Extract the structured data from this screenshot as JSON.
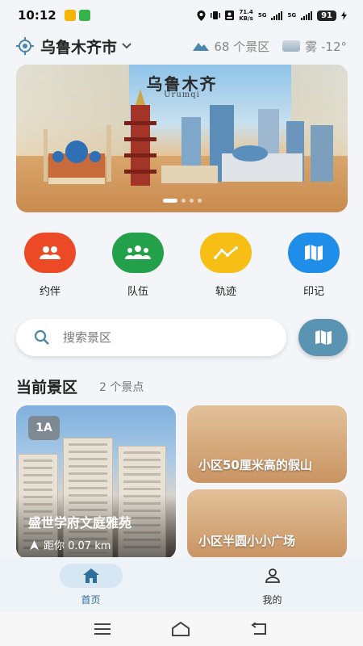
{
  "status_bar": {
    "time": "10:12",
    "net_speed": "71.4",
    "net_unit": "KB/s",
    "sig1": "5G",
    "sig2": "5G",
    "battery": "91"
  },
  "header": {
    "city": "乌鲁木齐市",
    "scenic_count": "68 个景区",
    "weather": "雾 -12°"
  },
  "banner": {
    "title": "乌鲁木齐",
    "subtitle": "Urumqi",
    "slides": 4,
    "active_slide": 1
  },
  "actions": [
    {
      "label": "约伴",
      "color": "#ec4a26",
      "icon": "people-icon"
    },
    {
      "label": "队伍",
      "color": "#22a14a",
      "icon": "group-icon"
    },
    {
      "label": "轨迹",
      "color": "#f7be16",
      "icon": "track-icon"
    },
    {
      "label": "印记",
      "color": "#1e8ee8",
      "icon": "map-icon"
    }
  ],
  "search": {
    "placeholder": "搜索景区"
  },
  "section": {
    "title": "当前景区",
    "count": "2 个景点"
  },
  "cards": {
    "main": {
      "badge": "1A",
      "name": "盛世学府文庭雅苑",
      "distance": "距你 0.07 km"
    },
    "side": [
      {
        "name": "小区50厘米高的假山"
      },
      {
        "name": "小区半圆小小广场"
      }
    ]
  },
  "nav": {
    "home": "首页",
    "mine": "我的"
  }
}
